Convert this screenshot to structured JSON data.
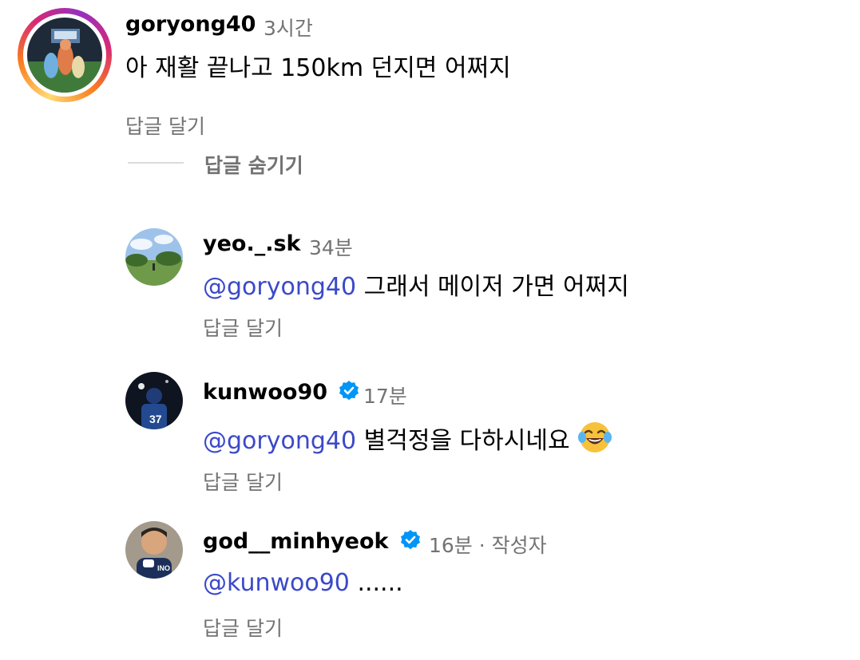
{
  "comments": [
    {
      "username": "goryong40",
      "time": "3시간",
      "text": "아 재활 끝나고 150km 던지면 어쩌지",
      "reply_label": "답글 달기",
      "avatar_icon": "mascots-on-baseball-field"
    }
  ],
  "thread": {
    "hide_label": "답글 숨기기"
  },
  "replies": [
    {
      "username": "yeo._.sk",
      "time": "34분",
      "mention": "@goryong40",
      "text": "그래서 메이저 가면 어쩌지",
      "reply_label": "답글 달기",
      "avatar_icon": "landscape-park"
    },
    {
      "username": "kunwoo90",
      "verified": true,
      "time": "17분",
      "mention": "@goryong40",
      "text": "별걱정을 다하시네요",
      "emoji": "face-with-tears-of-joy",
      "reply_label": "답글 달기",
      "avatar_icon": "player-number-37"
    },
    {
      "username": "god__minhyeok",
      "verified": true,
      "time": "16분",
      "separator": "·",
      "author_label": "작성자",
      "mention": "@kunwoo90",
      "text": "......",
      "reply_label": "답글 달기",
      "avatar_icon": "person-portrait"
    }
  ],
  "colors": {
    "mention": "#3b49c9",
    "verified": "#0095f6",
    "secondary_text": "#737373"
  }
}
